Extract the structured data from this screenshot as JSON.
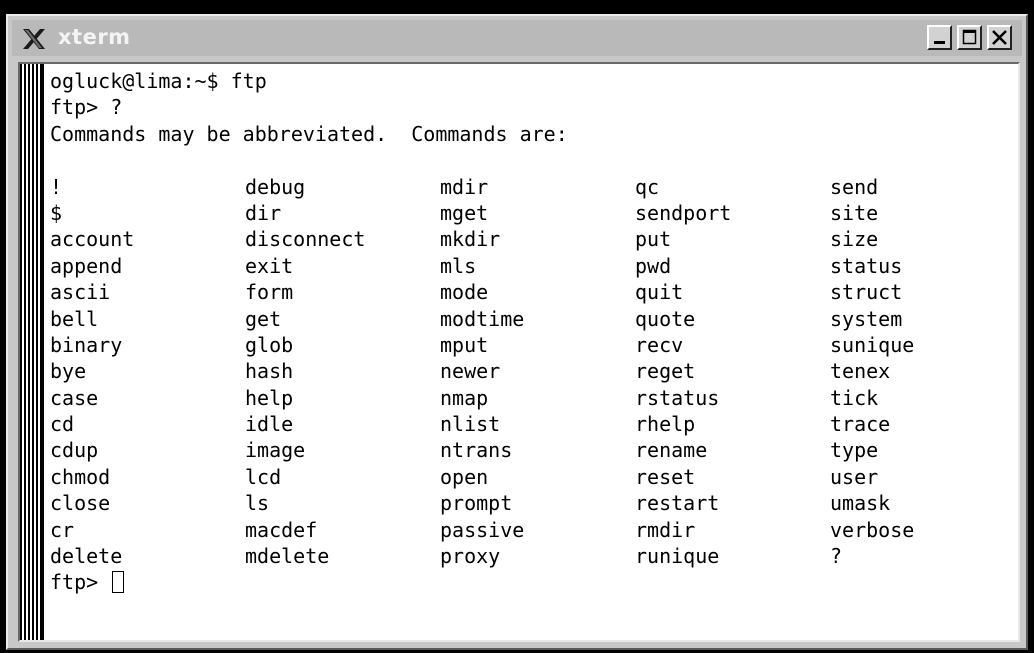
{
  "window": {
    "title": "xterm",
    "icon": "x-logo-icon",
    "controls": [
      "minimize-icon",
      "maximize-icon",
      "close-icon"
    ]
  },
  "terminal": {
    "lines": [
      "ogluck@lima:~$ ftp",
      "ftp> ?",
      "Commands may be abbreviated.  Commands are:",
      ""
    ],
    "command_columns": [
      [
        "!",
        "$",
        "account",
        "append",
        "ascii",
        "bell",
        "binary",
        "bye",
        "case",
        "cd",
        "cdup",
        "chmod",
        "close",
        "cr",
        "delete"
      ],
      [
        "debug",
        "dir",
        "disconnect",
        "exit",
        "form",
        "get",
        "glob",
        "hash",
        "help",
        "idle",
        "image",
        "lcd",
        "ls",
        "macdef",
        "mdelete"
      ],
      [
        "mdir",
        "mget",
        "mkdir",
        "mls",
        "mode",
        "modtime",
        "mput",
        "newer",
        "nmap",
        "nlist",
        "ntrans",
        "open",
        "prompt",
        "passive",
        "proxy"
      ],
      [
        "qc",
        "sendport",
        "put",
        "pwd",
        "quit",
        "quote",
        "recv",
        "reget",
        "rstatus",
        "rhelp",
        "rename",
        "reset",
        "restart",
        "rmdir",
        "runique"
      ],
      [
        "send",
        "site",
        "size",
        "status",
        "struct",
        "system",
        "sunique",
        "tenex",
        "tick",
        "trace",
        "type",
        "user",
        "umask",
        "verbose",
        "?"
      ]
    ],
    "prompt": "ftp> "
  }
}
